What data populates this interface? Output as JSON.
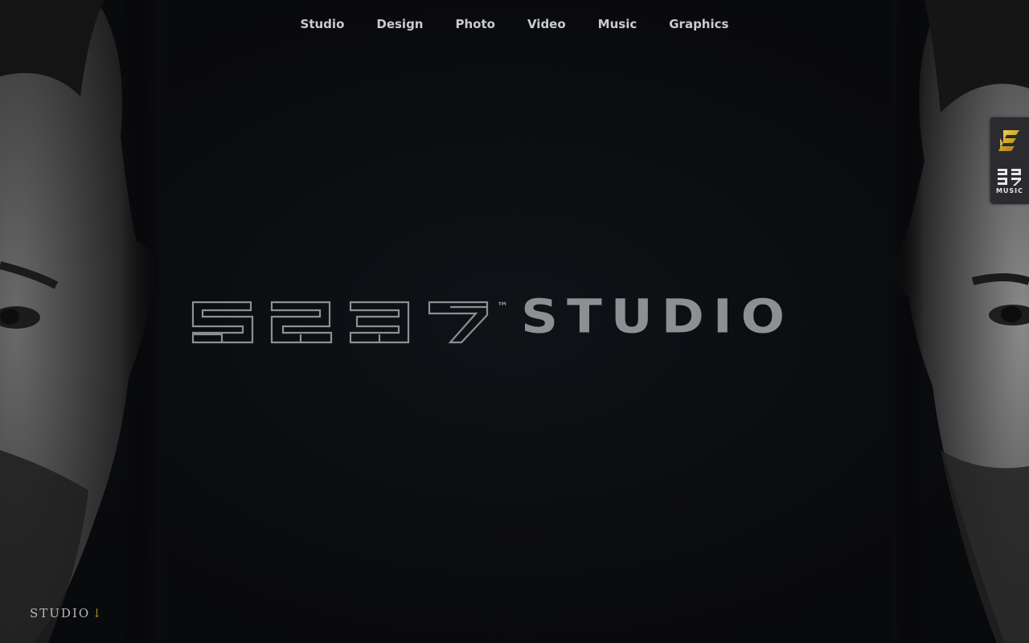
{
  "nav": {
    "items": [
      {
        "label": "Studio"
      },
      {
        "label": "Design"
      },
      {
        "label": "Photo"
      },
      {
        "label": "Video"
      },
      {
        "label": "Music"
      },
      {
        "label": "Graphics"
      }
    ]
  },
  "hero": {
    "logo_mark": "5237",
    "logo_tm": "™",
    "logo_word": "STUDIO"
  },
  "side_tab": {
    "brand_icon": "gold-e-icon",
    "music_icon": "5237-music-icon",
    "music_label": "MUSIC"
  },
  "section_link": {
    "label": "STUDIO",
    "arrow": "↓",
    "arrow_color": "#a38d24"
  },
  "colors": {
    "background": "#0b0c0f",
    "nav_text": "#c9cbcf",
    "logo_text": "#8e8f92",
    "side_tab_bg": "#2a2b2e",
    "gold": "#d4a72c"
  }
}
